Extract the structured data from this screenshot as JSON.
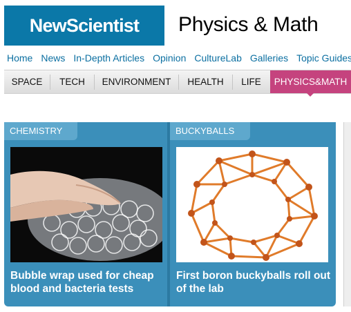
{
  "logo": {
    "text": "NewScientist"
  },
  "section_title": "Physics & Math",
  "top_nav": [
    "Home",
    "News",
    "In-Depth Articles",
    "Opinion",
    "CultureLab",
    "Galleries",
    "Topic Guides"
  ],
  "category_nav": [
    "SPACE",
    "TECH",
    "ENVIRONMENT",
    "HEALTH",
    "LIFE",
    "PHYSICS&MATH"
  ],
  "active_category": "PHYSICS&MATH",
  "cards": [
    {
      "tag": "CHEMISTRY",
      "headline": "Bubble wrap used for cheap blood and bacteria tests"
    },
    {
      "tag": "BUCKYBALLS",
      "headline": "First boron buckyballs roll out of the lab"
    }
  ],
  "colors": {
    "brand_blue": "#0b78a8",
    "active_pink": "#c5437e",
    "card_blue": "#3b8fba",
    "link_blue": "#0b6fa1"
  }
}
